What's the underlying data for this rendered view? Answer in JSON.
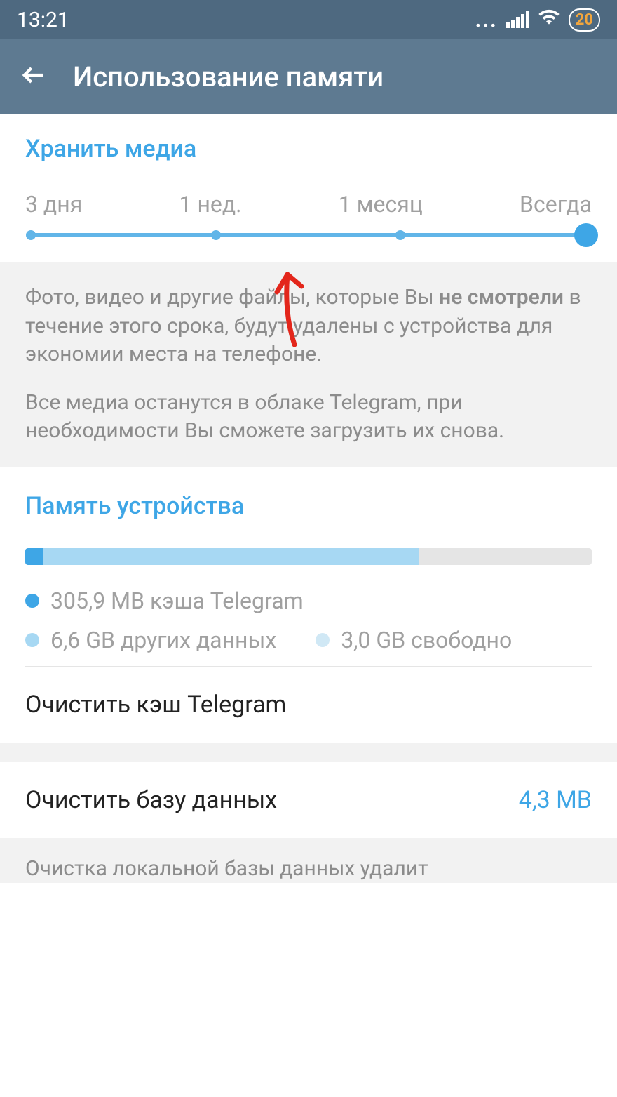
{
  "status": {
    "time": "13:21",
    "battery": "20"
  },
  "header": {
    "title": "Использование памяти"
  },
  "keep_media": {
    "title": "Хранить медиа",
    "options": [
      "3 дня",
      "1 нед.",
      "1 месяц",
      "Всегда"
    ],
    "selected_index": 3
  },
  "info": {
    "para1_prefix": "Фото, видео и другие файлы, которые Вы ",
    "para1_bold": "не смотрели",
    "para1_suffix": " в течение этого срока, будут удалены с устройства для экономии места на телефоне.",
    "para2": "Все медиа останутся в облаке Telegram, при необходимости Вы сможете загрузить их снова."
  },
  "device": {
    "title": "Память устройства",
    "legend": {
      "cache": "305,9 MB кэша Telegram",
      "other": "6,6 GB других данных",
      "free": "3,0 GB свободно"
    }
  },
  "actions": {
    "clear_cache": "Очистить кэш Telegram",
    "clear_db": "Очистить базу данных",
    "clear_db_value": "4,3 MB"
  },
  "bottom_info": {
    "text": "Очистка локальной базы данных удалит"
  }
}
